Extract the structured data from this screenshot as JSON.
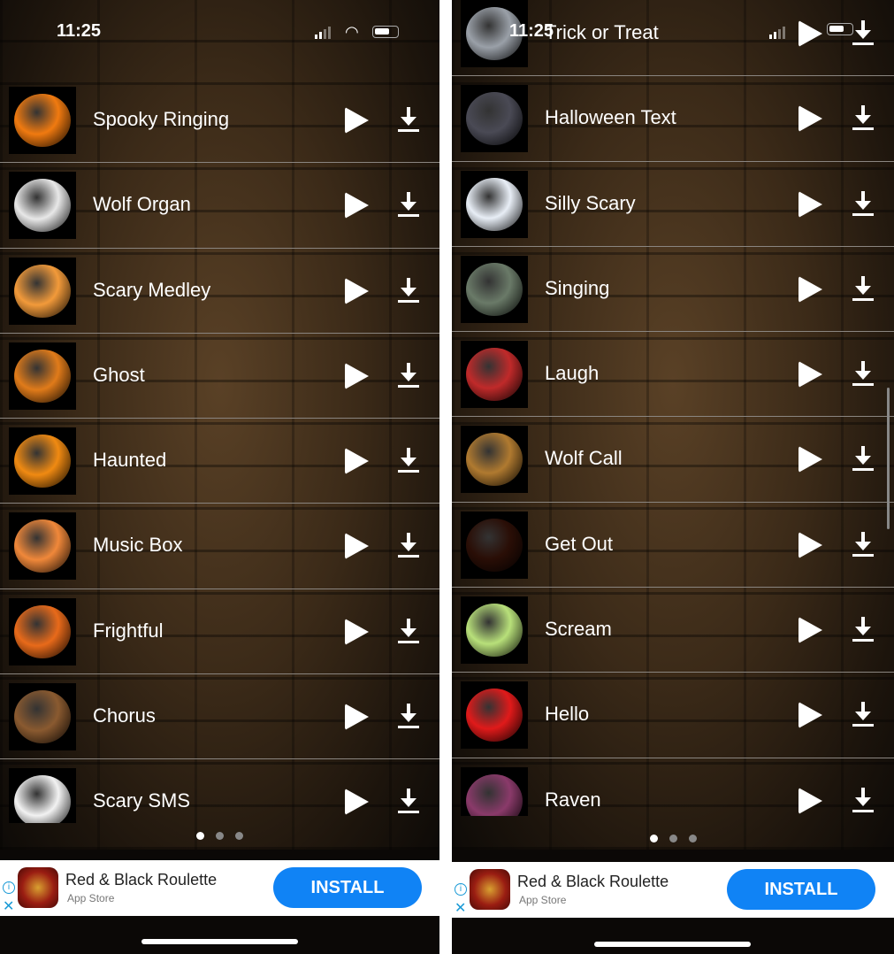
{
  "status": {
    "time": "11:25"
  },
  "left": {
    "items": [
      {
        "title": "Spooky Ringing",
        "icon": "jack-o-lantern-icon",
        "color": "#f07a10"
      },
      {
        "title": "Wolf Organ",
        "icon": "scream-mask-icon",
        "color": "#e8e8e8"
      },
      {
        "title": "Scary Medley",
        "icon": "jack-o-lantern-icon",
        "color": "#f29a3a"
      },
      {
        "title": "Ghost",
        "icon": "jack-o-lantern-icon",
        "color": "#e07b1a"
      },
      {
        "title": "Haunted",
        "icon": "jack-o-lantern-icon",
        "color": "#f08a12"
      },
      {
        "title": "Music Box",
        "icon": "jack-o-lantern-icon",
        "color": "#f0883a"
      },
      {
        "title": "Frightful",
        "icon": "pirate-pumpkin-icon",
        "color": "#e86a1a"
      },
      {
        "title": "Chorus",
        "icon": "witch-hat-icon",
        "color": "#8a5a30"
      },
      {
        "title": "Scary SMS",
        "icon": "ghost-icon",
        "color": "#f2f2f2"
      }
    ],
    "page_dots": {
      "count": 3,
      "active": 0
    }
  },
  "right": {
    "items": [
      {
        "title": "Trick or Treat",
        "icon": "gargoyle-icon",
        "color": "#9aa0a8"
      },
      {
        "title": "Halloween Text",
        "icon": "wizard-hat-icon",
        "color": "#4a4a55"
      },
      {
        "title": "Silly Scary",
        "icon": "ghost-icon",
        "color": "#e8eef6"
      },
      {
        "title": "Singing",
        "icon": "frankenstein-icon",
        "color": "#6a7a68"
      },
      {
        "title": "Laugh",
        "icon": "dracula-icon",
        "color": "#c02a2a"
      },
      {
        "title": "Wolf Call",
        "icon": "werewolf-icon",
        "color": "#b07a30"
      },
      {
        "title": "Get Out",
        "icon": "black-cat-icon",
        "color": "#2a0e06"
      },
      {
        "title": "Scream",
        "icon": "skeleton-icon",
        "color": "#b8e07a"
      },
      {
        "title": "Hello",
        "icon": "skull-crossbones-icon",
        "color": "#e01a1a"
      },
      {
        "title": "Raven",
        "icon": "bat-icon",
        "color": "#8a3a6a"
      }
    ],
    "page_dots": {
      "count": 3,
      "active": 0
    }
  },
  "ad": {
    "title": "Red & Black Roulette",
    "subtitle": "App Store",
    "button": "INSTALL",
    "info": "i",
    "close": "✕",
    "button_color": "#1083f5"
  }
}
